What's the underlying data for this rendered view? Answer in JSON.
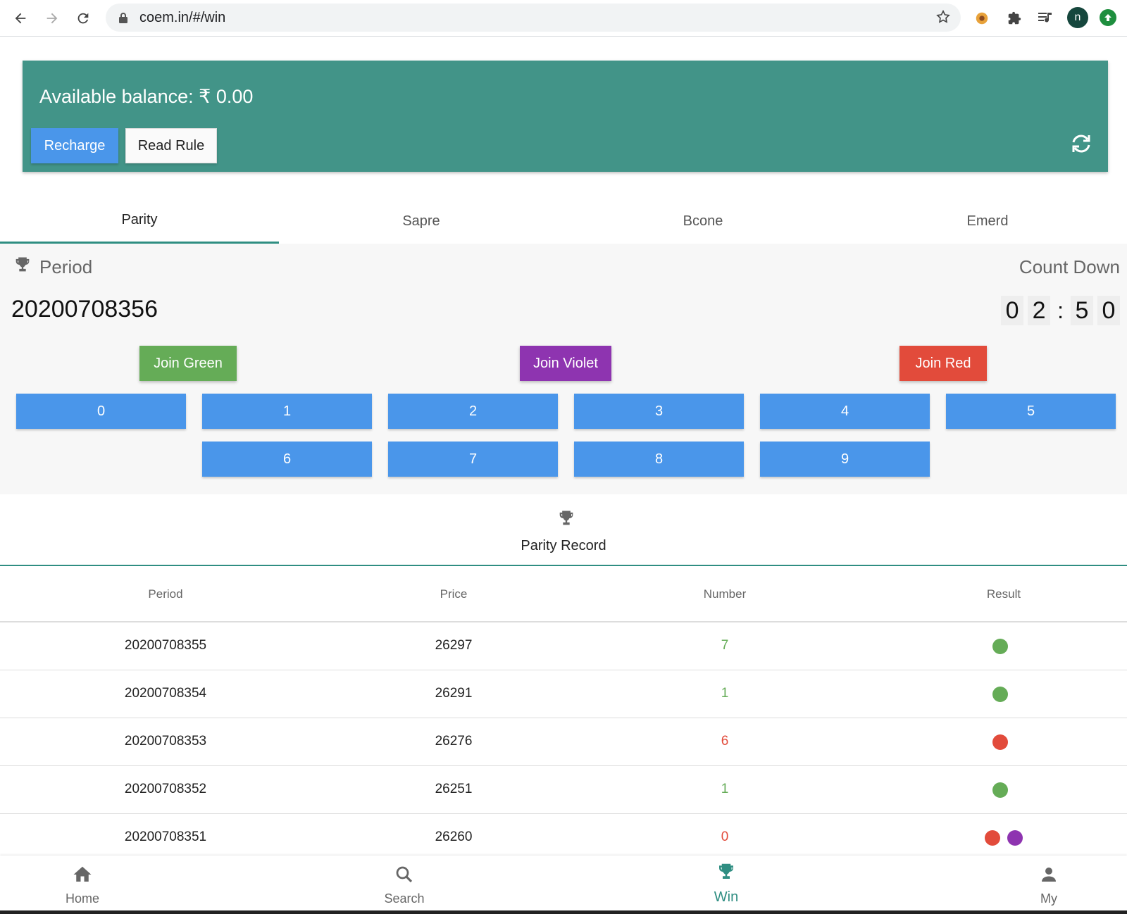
{
  "browser": {
    "url": "coem.in/#/win",
    "profile_initial": "n"
  },
  "balance": {
    "text": "Available balance: ₹ 0.00",
    "recharge_label": "Recharge",
    "rule_label": "Read Rule"
  },
  "tabs": [
    {
      "label": "Parity",
      "active": true
    },
    {
      "label": "Sapre",
      "active": false
    },
    {
      "label": "Bcone",
      "active": false
    },
    {
      "label": "Emerd",
      "active": false
    }
  ],
  "game": {
    "period_label": "Period",
    "countdown_label": "Count Down",
    "period_number": "20200708356",
    "timer": {
      "d1": "0",
      "d2": "2",
      "sep": ":",
      "d3": "5",
      "d4": "0"
    },
    "join_green": "Join Green",
    "join_violet": "Join Violet",
    "join_red": "Join Red",
    "numbers": [
      "0",
      "1",
      "2",
      "3",
      "4",
      "5",
      "6",
      "7",
      "8",
      "9"
    ]
  },
  "record": {
    "title": "Parity Record",
    "headers": [
      "Period",
      "Price",
      "Number",
      "Result"
    ],
    "rows": [
      {
        "period": "20200708355",
        "price": "26297",
        "number": "7",
        "number_color": "green",
        "result": [
          "green"
        ]
      },
      {
        "period": "20200708354",
        "price": "26291",
        "number": "1",
        "number_color": "green",
        "result": [
          "green"
        ]
      },
      {
        "period": "20200708353",
        "price": "26276",
        "number": "6",
        "number_color": "red",
        "result": [
          "red"
        ]
      },
      {
        "period": "20200708352",
        "price": "26251",
        "number": "1",
        "number_color": "green",
        "result": [
          "green"
        ]
      },
      {
        "period": "20200708351",
        "price": "26260",
        "number": "0",
        "number_color": "red",
        "result": [
          "red",
          "violet"
        ]
      }
    ]
  },
  "colors": {
    "green": "#65ac57",
    "red": "#e24b3b",
    "violet": "#8e34b0",
    "teal": "#429488",
    "blue": "#4a96ea"
  },
  "bottom_nav": [
    {
      "label": "Home",
      "icon": "home-icon",
      "active": false
    },
    {
      "label": "Search",
      "icon": "search-icon",
      "active": false
    },
    {
      "label": "Win",
      "icon": "trophy-icon",
      "active": true
    },
    {
      "label": "My",
      "icon": "person-icon",
      "active": false
    }
  ]
}
